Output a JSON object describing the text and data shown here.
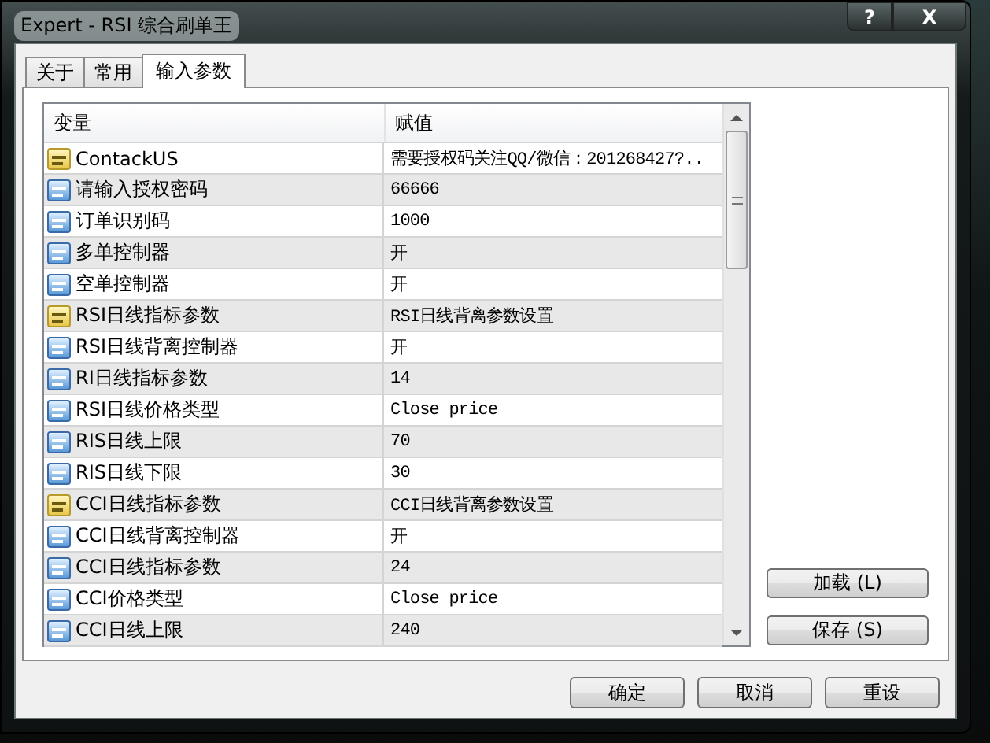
{
  "window": {
    "title": "Expert - RSI 综合刷单王",
    "help_button": "?",
    "close_button": "X"
  },
  "tabs": [
    {
      "label": "关于",
      "selected": false
    },
    {
      "label": "常用",
      "selected": false
    },
    {
      "label": "输入参数",
      "selected": true
    }
  ],
  "table": {
    "columns": [
      "变量",
      "赋值"
    ],
    "rows": [
      {
        "kind": "text",
        "name": "ContackUS",
        "value": "需要授权码关注QQ/微信：201268427?.."
      },
      {
        "kind": "number",
        "name": "请输入授权密码",
        "value": "66666"
      },
      {
        "kind": "number",
        "name": "订单识别码",
        "value": "1000"
      },
      {
        "kind": "number",
        "name": "多单控制器",
        "value": "开"
      },
      {
        "kind": "number",
        "name": "空单控制器",
        "value": "开"
      },
      {
        "kind": "text",
        "name": "RSI日线指标参数",
        "value": "RSI日线背离参数设置"
      },
      {
        "kind": "number",
        "name": "RSI日线背离控制器",
        "value": "开"
      },
      {
        "kind": "number",
        "name": "RI日线指标参数",
        "value": "14"
      },
      {
        "kind": "number",
        "name": "RSI日线价格类型",
        "value": "Close price"
      },
      {
        "kind": "number",
        "name": "RIS日线上限",
        "value": "70"
      },
      {
        "kind": "number",
        "name": "RIS日线下限",
        "value": "30"
      },
      {
        "kind": "text",
        "name": "CCI日线指标参数",
        "value": "CCI日线背离参数设置"
      },
      {
        "kind": "number",
        "name": "CCI日线背离控制器",
        "value": "开"
      },
      {
        "kind": "number",
        "name": "CCI日线指标参数",
        "value": "24"
      },
      {
        "kind": "number",
        "name": "CCI价格类型",
        "value": "Close price"
      },
      {
        "kind": "number",
        "name": "CCI日线上限",
        "value": "240"
      }
    ]
  },
  "side_buttons": [
    "加载 (L)",
    "保存 (S)"
  ],
  "buttons": [
    "确定",
    "取消",
    "重设"
  ]
}
